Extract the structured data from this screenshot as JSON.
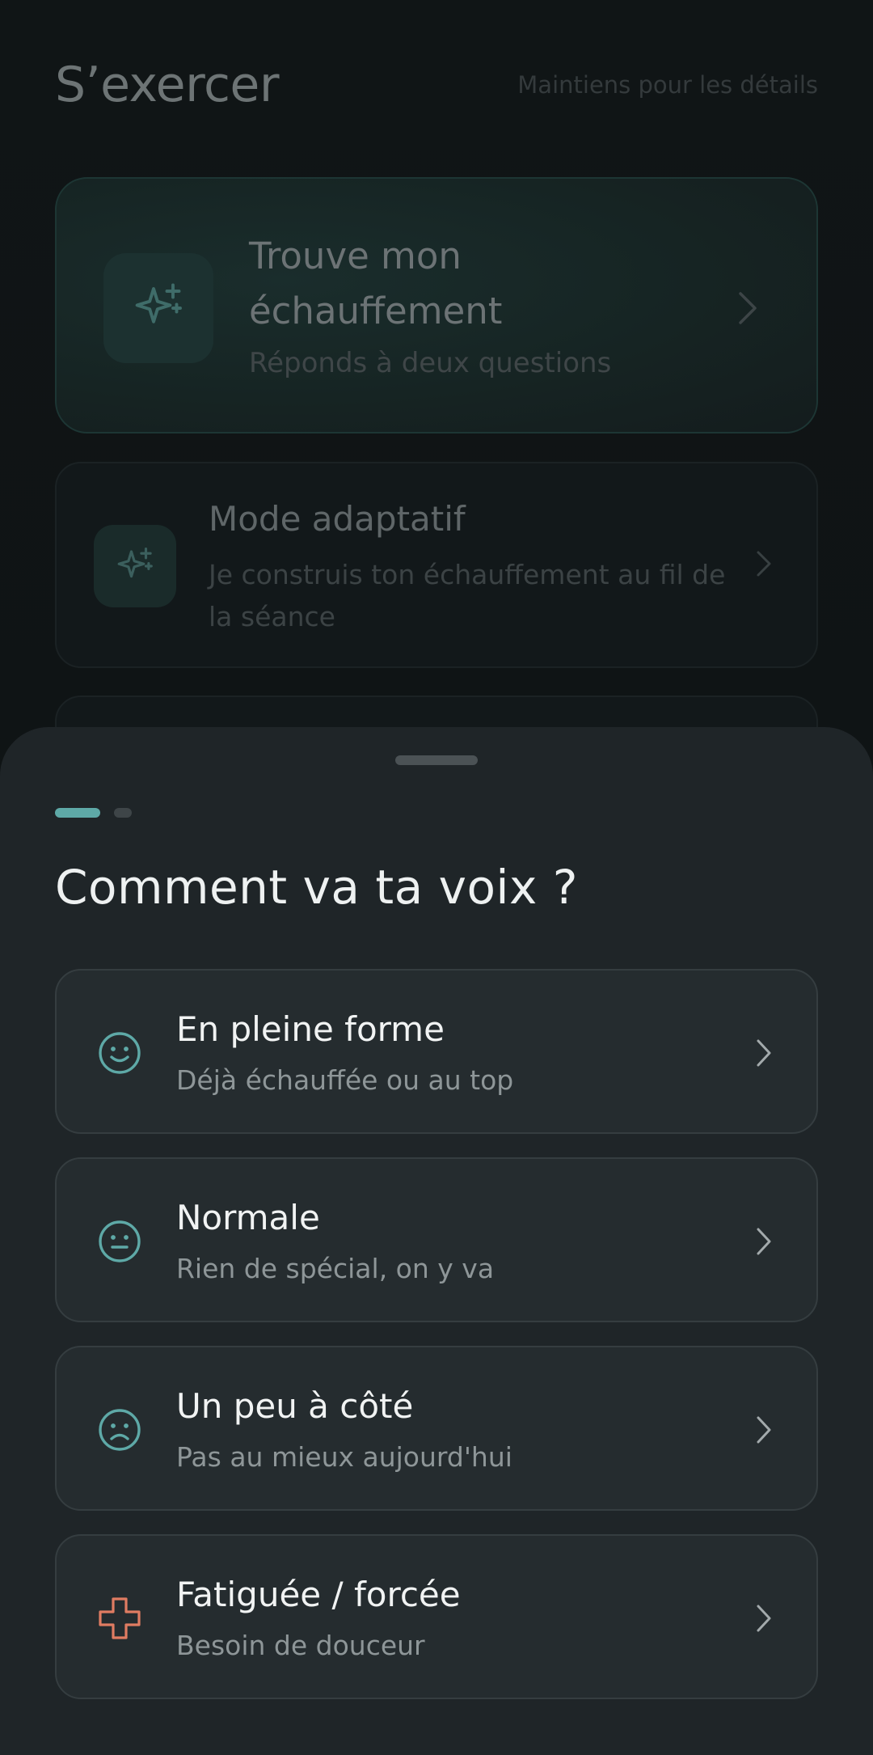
{
  "background": {
    "title": "S’exercer",
    "hint": "Maintiens pour les détails",
    "featured_card": {
      "title": "Trouve mon échauffement",
      "subtitle": "Réponds à deux questions",
      "icon": "sparkles-icon"
    },
    "mode_card": {
      "title": "Mode adaptatif",
      "subtitle": "Je construis ton échauffement au fil de la séance",
      "icon": "sparkles-icon"
    }
  },
  "sheet": {
    "step": {
      "current": 1,
      "total": 2
    },
    "title": "Comment va ta voix ?",
    "options": [
      {
        "title": "En pleine forme",
        "subtitle": "Déjà échauffée ou au top",
        "icon": "smile-icon",
        "color": "#5ea9a7"
      },
      {
        "title": "Normale",
        "subtitle": "Rien de spécial, on y va",
        "icon": "neutral-face-icon",
        "color": "#5ea9a7"
      },
      {
        "title": "Un peu à côté",
        "subtitle": "Pas au mieux aujourd'hui",
        "icon": "frown-icon",
        "color": "#5ea9a7"
      },
      {
        "title": "Fatiguée / forcée",
        "subtitle": "Besoin de douceur",
        "icon": "medical-cross-icon",
        "color": "#e07c62"
      }
    ]
  },
  "colors": {
    "accent": "#5ea9a7",
    "warning": "#e07c62",
    "sheet_background": "#1f2528",
    "option_background": "#252c2f"
  }
}
